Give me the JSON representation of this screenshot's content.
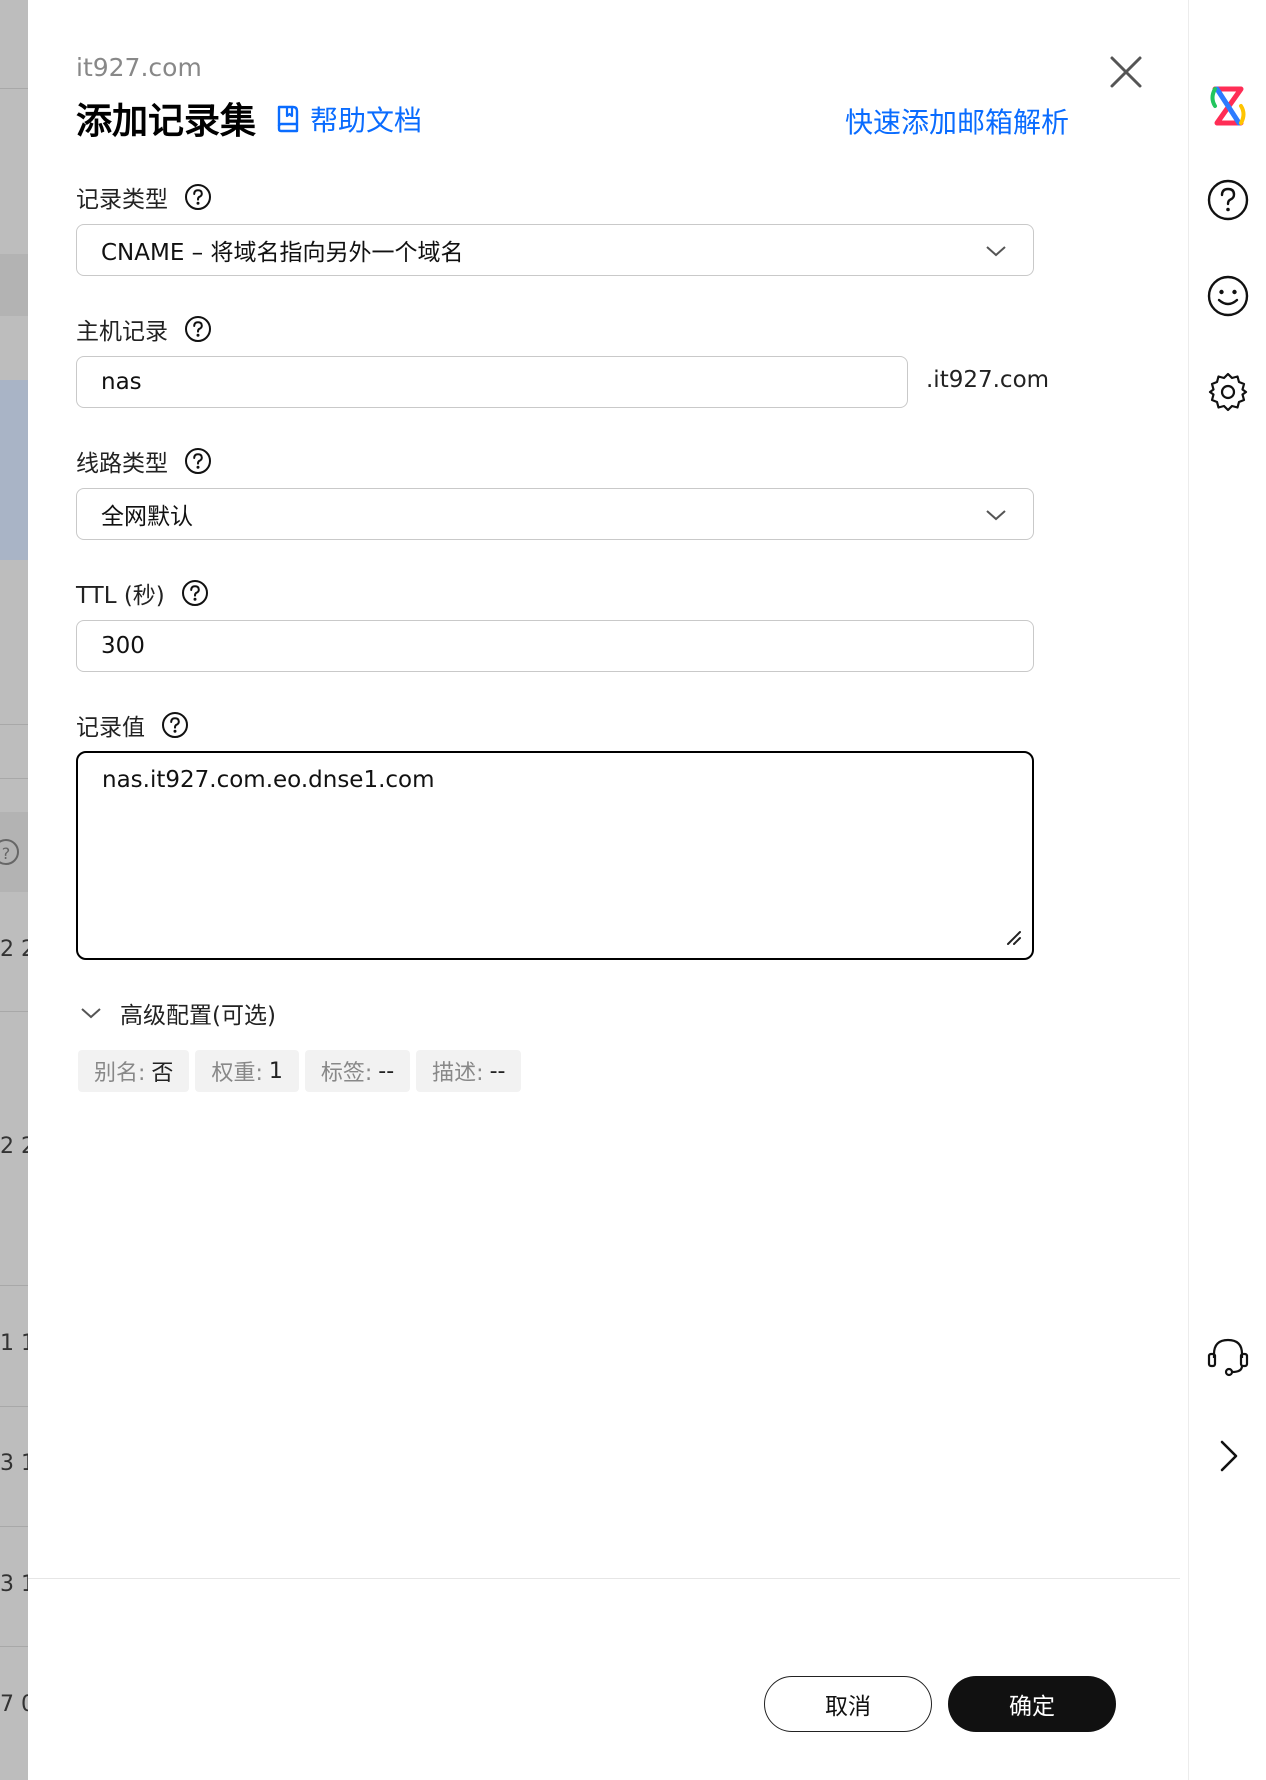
{
  "background": {
    "row_fragments": [
      "2 2",
      "2 2",
      "1 1",
      "3 1",
      "3 1",
      "7 0"
    ]
  },
  "drawer": {
    "domain": "it927.com",
    "title": "添加记录集",
    "help_doc_label": "帮助文档",
    "quick_mail_label": "快速添加邮箱解析"
  },
  "form": {
    "record_type": {
      "label": "记录类型",
      "value": "CNAME – 将域名指向另外一个域名"
    },
    "host_record": {
      "label": "主机记录",
      "value": "nas",
      "suffix": ".it927.com"
    },
    "line_type": {
      "label": "线路类型",
      "value": "全网默认"
    },
    "ttl": {
      "label": "TTL (秒)",
      "value": "300"
    },
    "record_value": {
      "label": "记录值",
      "value": "nas.it927.com.eo.dnse1.com"
    },
    "advanced": {
      "label": "高级配置(可选)",
      "tags": [
        {
          "key": "别名:",
          "value": "否"
        },
        {
          "key": "权重:",
          "value": "1"
        },
        {
          "key": "标签:",
          "value": "--"
        },
        {
          "key": "描述:",
          "value": "--"
        }
      ]
    }
  },
  "footer": {
    "cancel_label": "取消",
    "confirm_label": "确定"
  },
  "colors": {
    "link": "#0a6cff",
    "primary_button": "#111111"
  },
  "sidebar_icons": [
    "app-logo-icon",
    "help-circle-icon",
    "smiley-icon",
    "gear-icon",
    "headset-icon",
    "chevron-right-icon"
  ]
}
